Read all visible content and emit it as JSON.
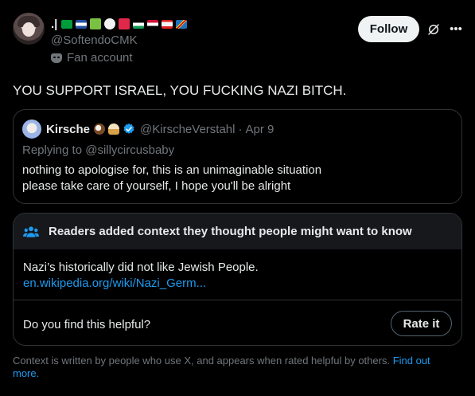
{
  "post": {
    "author_name_prefix": ".|",
    "author_handle": "@SoftendoCMK",
    "affiliation_label": "Fan account",
    "follow_label": "Follow",
    "text": "YOU SUPPORT ISRAEL, YOU FUCKING NAZI BITCH.",
    "flag_colors": [
      "#009c3b",
      "#1f4fa1",
      "#7ac142",
      "#f2f2f2",
      "#e0284a",
      "#149954",
      "#d21034",
      "#f4f4f4",
      "#1e73be"
    ]
  },
  "quote": {
    "author_name": "Kirsche",
    "author_handle": "@KirscheVerstahl",
    "separator": "·",
    "date": "Apr 9",
    "replying_to": "Replying to @sillycircusbaby",
    "lines": [
      "nothing to apologise for, this is an unimaginable situation",
      "please take care of yourself, I hope you'll be alright"
    ]
  },
  "community_note": {
    "title": "Readers added context they thought people might want to know",
    "body": "Nazi’s historically did not like Jewish People.",
    "link": "en.wikipedia.org/wiki/Nazi_Germ...",
    "helpful_prompt": "Do you find this helpful?",
    "rate_label": "Rate it"
  },
  "footer": {
    "text": "Context is written by people who use X, and appears when rated helpful by others.",
    "link": "Find out more."
  },
  "colors": {
    "accent": "#1d9bf0",
    "muted": "#71767b",
    "border": "#2f3336"
  }
}
